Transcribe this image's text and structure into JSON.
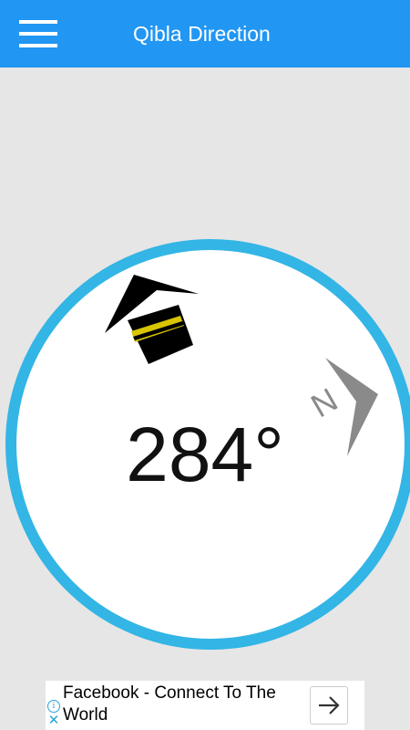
{
  "app_bar": {
    "title": "Qibla Direction",
    "color": "#2196f3",
    "menu_icon": "hamburger-menu-icon"
  },
  "compass": {
    "heading_text": "284°",
    "ring_color": "#33b5e5",
    "kaaba_icon": "kaaba-icon",
    "qibla_pointer_icon": "qibla-pointer-icon",
    "north_indicator_icon": "north-indicator-icon",
    "north_label": "N"
  },
  "ad": {
    "text": "Facebook - Connect To The World",
    "info_icon": "ad-info-icon",
    "close_icon": "ad-close-icon",
    "cta_icon": "arrow-right-icon"
  }
}
